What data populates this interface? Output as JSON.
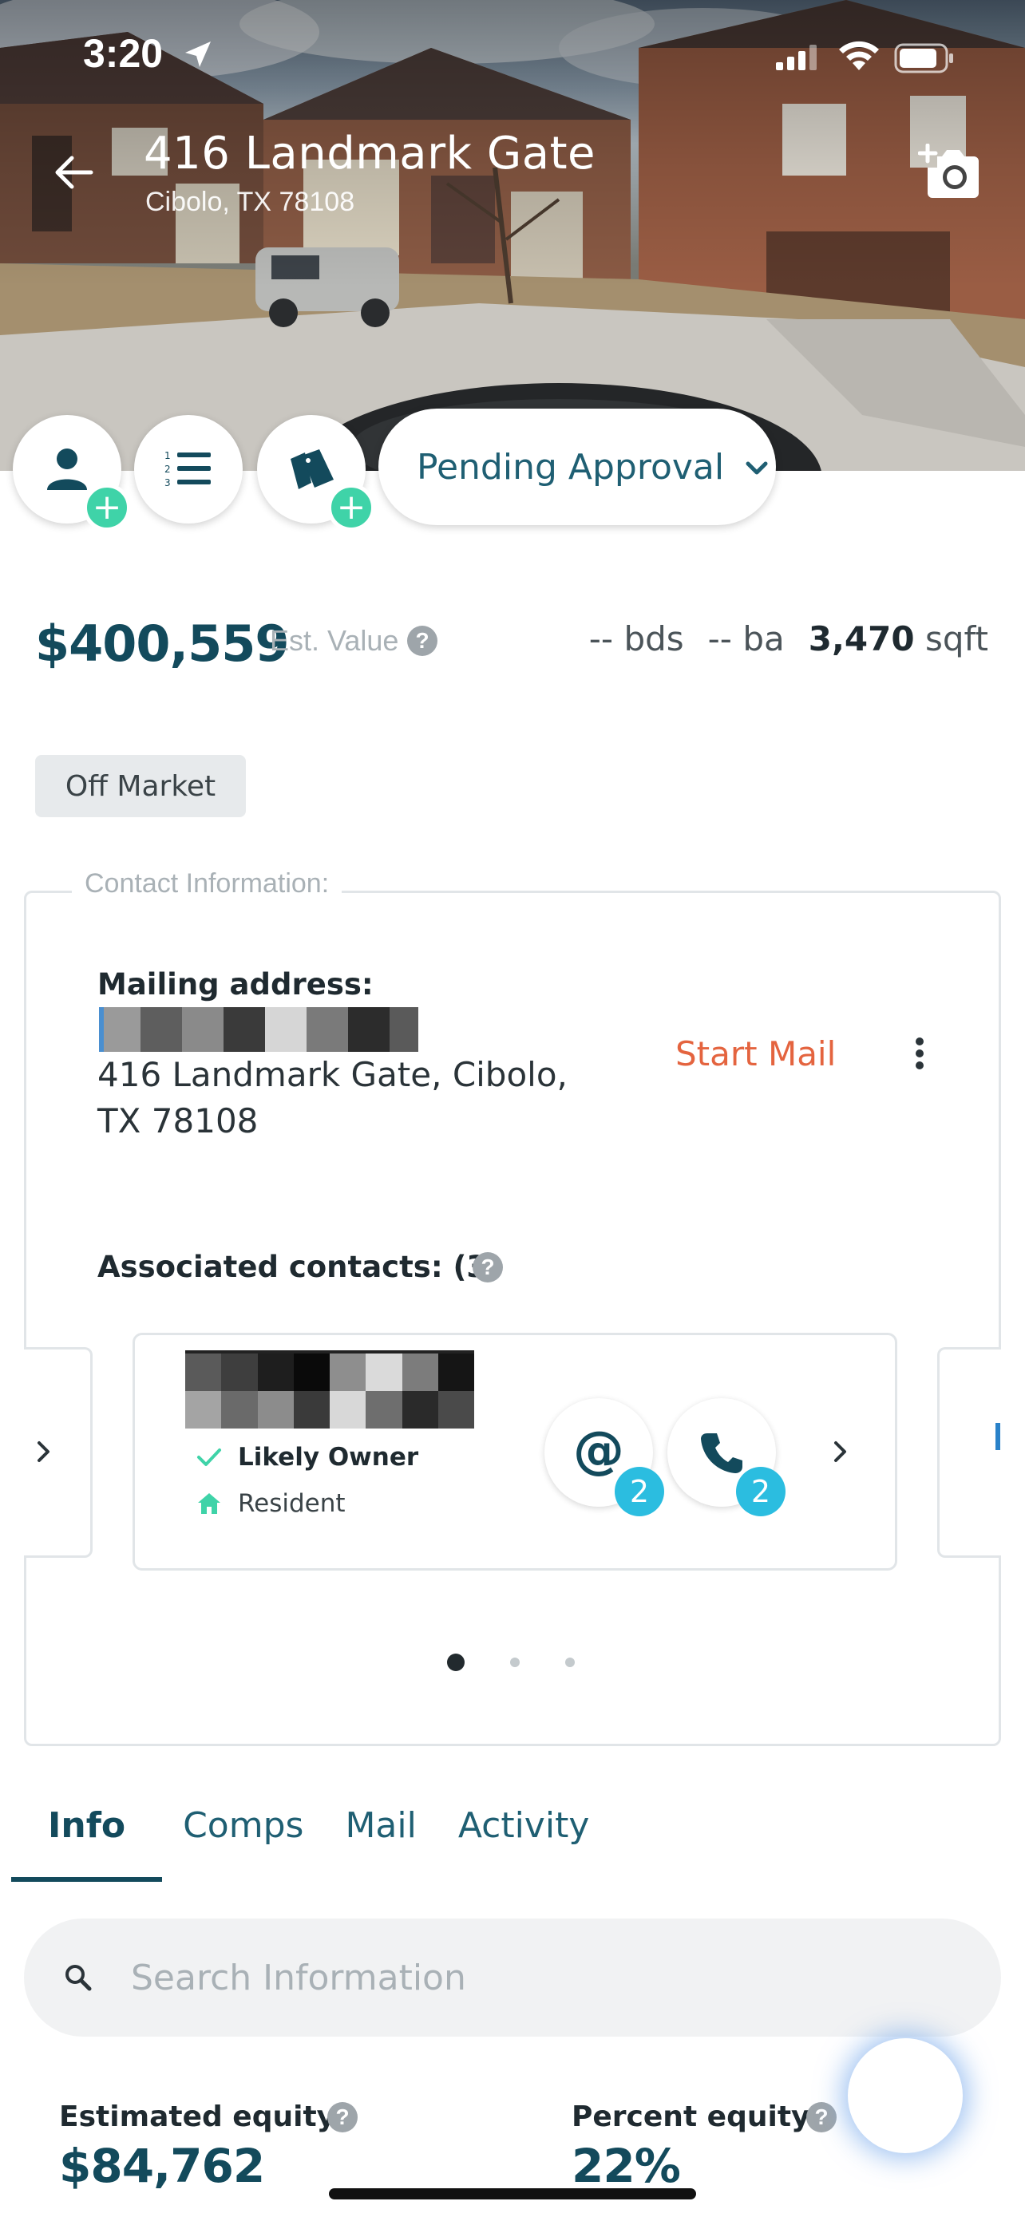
{
  "status_bar": {
    "time": "3:20"
  },
  "header": {
    "title": "416 Landmark Gate",
    "subtitle": "Cibolo, TX 78108"
  },
  "actions": {
    "status": "Pending Approval"
  },
  "summary": {
    "price": "$400,559",
    "price_label": "Est. Value",
    "beds": "-- bds",
    "baths": "-- ba",
    "sqft_value": "3,470",
    "sqft_unit": "sqft",
    "market_status": "Off Market"
  },
  "contact": {
    "legend": "Contact Information:",
    "mailing_label": "Mailing address:",
    "mailing_address": "416 Landmark Gate, Cibolo, TX 78108",
    "start_mail": "Start Mail",
    "associated_label": "Associated contacts: (3)",
    "card": {
      "tag_owner": "Likely Owner",
      "tag_resident": "Resident",
      "email_count": "2",
      "phone_count": "2"
    },
    "pages": 3,
    "active_page": 1
  },
  "tabs": [
    {
      "label": "Info",
      "active": true
    },
    {
      "label": "Comps",
      "active": false
    },
    {
      "label": "Mail",
      "active": false
    },
    {
      "label": "Activity",
      "active": false
    }
  ],
  "search": {
    "placeholder": "Search Information",
    "value": ""
  },
  "equity": {
    "estimated_label": "Estimated equity:",
    "estimated_value": "$84,762",
    "percent_label": "Percent equity:",
    "percent_value": "22%"
  },
  "colors": {
    "brand": "#134a5c",
    "accent_green": "#3fd3a8",
    "accent_orange": "#e4643f",
    "badge_blue": "#2bbde0"
  }
}
